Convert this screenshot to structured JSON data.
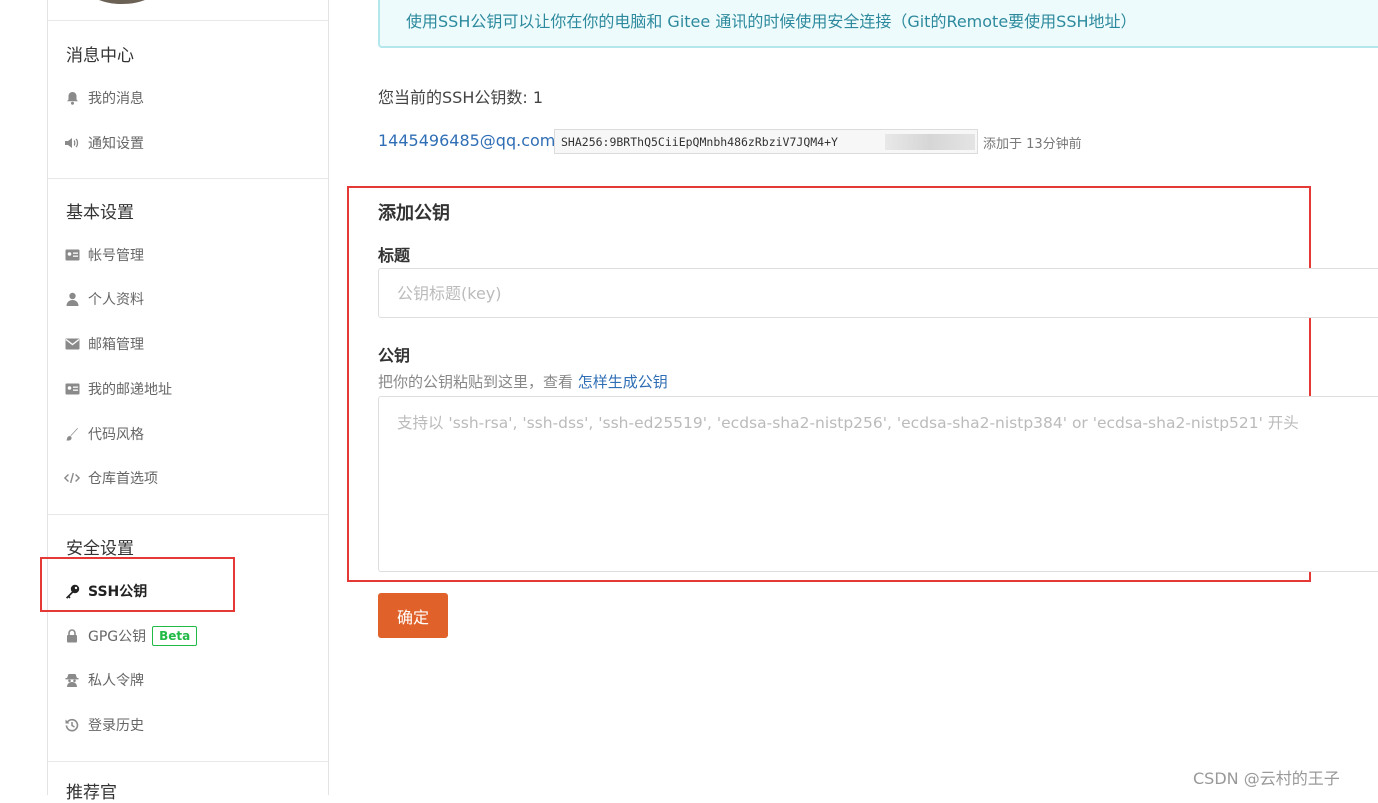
{
  "sidebar": {
    "sections": [
      {
        "title": "消息中心",
        "items": [
          {
            "label": "我的消息",
            "icon": "bell-icon"
          },
          {
            "label": "通知设置",
            "icon": "speaker-icon"
          }
        ]
      },
      {
        "title": "基本设置",
        "items": [
          {
            "label": "帐号管理",
            "icon": "id-card-icon"
          },
          {
            "label": "个人资料",
            "icon": "user-icon"
          },
          {
            "label": "邮箱管理",
            "icon": "envelope-icon"
          },
          {
            "label": "我的邮递地址",
            "icon": "address-card-icon"
          },
          {
            "label": "代码风格",
            "icon": "brush-icon"
          },
          {
            "label": "仓库首选项",
            "icon": "code-icon"
          }
        ]
      },
      {
        "title": "安全设置",
        "items": [
          {
            "label": "SSH公钥",
            "icon": "key-icon",
            "active": true
          },
          {
            "label": "GPG公钥",
            "icon": "lock-icon",
            "badge": "Beta"
          },
          {
            "label": "私人令牌",
            "icon": "spy-icon"
          },
          {
            "label": "登录历史",
            "icon": "history-icon"
          }
        ]
      },
      {
        "title": "推荐官"
      }
    ]
  },
  "main": {
    "notice": "使用SSH公钥可以让你在你的电脑和 Gitee 通讯的时候使用安全连接（Git的Remote要使用SSH地址）",
    "key_count_text": "您当前的SSH公钥数: 1",
    "keys": [
      {
        "email": "1445496485@qq.com",
        "fingerprint": "SHA256:9BRThQ5CiiEpQMnbh486zRbziV7JQM4+Y",
        "added": "添加于 13分钟前"
      }
    ],
    "form": {
      "title": "添加公钥",
      "title_label": "标题",
      "title_placeholder": "公钥标题(key)",
      "key_label": "公钥",
      "hint": "把你的公钥粘贴到这里，查看",
      "hint_link": "怎样生成公钥",
      "key_placeholder": "支持以 'ssh-rsa', 'ssh-dss', 'ssh-ed25519', 'ecdsa-sha2-nistp256', 'ecdsa-sha2-nistp384' or 'ecdsa-sha2-nistp521' 开头",
      "submit": "确定"
    }
  },
  "watermark": "CSDN @云村的王子",
  "colors": {
    "accent": "#e0622a",
    "link": "#2f6eb5",
    "highlight_box": "#e53935",
    "beta": "#21ba45"
  }
}
